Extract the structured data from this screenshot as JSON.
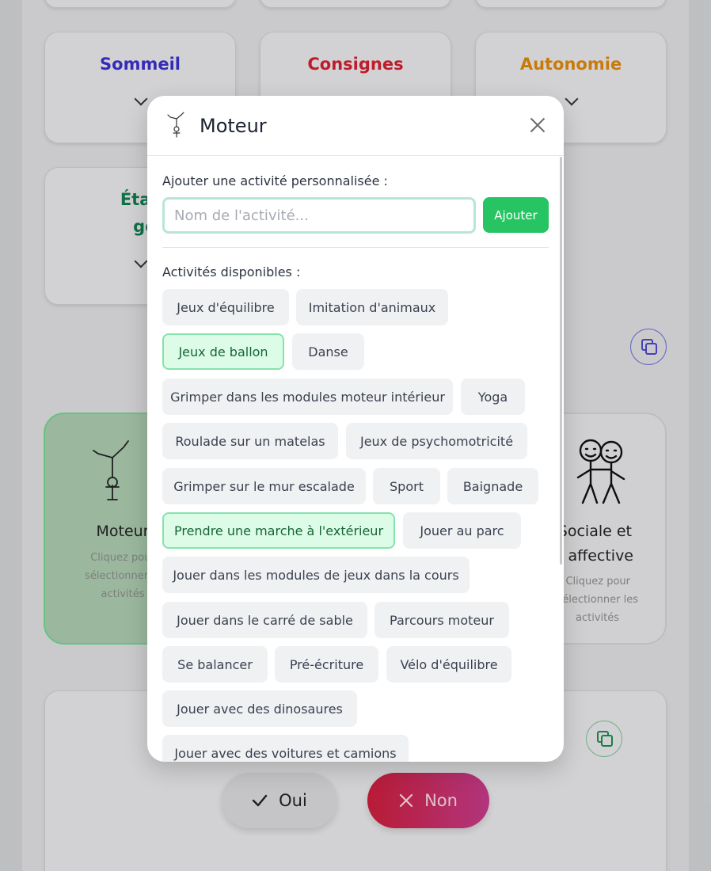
{
  "background": {
    "cards": [
      {
        "title": "Sommeil",
        "color": "#3b2fc9"
      },
      {
        "title": "Consignes",
        "color": "#d01f2f"
      },
      {
        "title": "Autonomie",
        "color": "#d9860a"
      }
    ],
    "state_card": {
      "line1": "État de",
      "line2": "génér",
      "color": "#127a4e"
    },
    "categories": {
      "moteur": {
        "title": "Moteur",
        "hint_line1": "Cliquez pour",
        "hint_line2": "sélectionner le",
        "hint_line3": "activités"
      },
      "sociale": {
        "title_line1": "Sociale et",
        "title_line2": "affective",
        "hint_line1": "Cliquez pour",
        "hint_line2": "électionner les",
        "hint_line3": "activités"
      }
    },
    "buttons": {
      "yes_label": "Oui",
      "no_label": "Non"
    }
  },
  "modal": {
    "title": "Moteur",
    "custom_label": "Ajouter une activité personnalisée :",
    "input_placeholder": "Nom de l'activité...",
    "add_label": "Ajouter",
    "available_label": "Activités disponibles :",
    "activities": [
      {
        "label": "Jeux d'équilibre",
        "selected": false
      },
      {
        "label": "Imitation d'animaux",
        "selected": false
      },
      {
        "label": "Jeux de ballon",
        "selected": true
      },
      {
        "label": "Danse",
        "selected": false
      },
      {
        "label": "Grimper dans les modules moteur intérieur",
        "selected": false
      },
      {
        "label": "Yoga",
        "selected": false
      },
      {
        "label": "Roulade sur un matelas",
        "selected": false
      },
      {
        "label": "Jeux de psychomotricité",
        "selected": false
      },
      {
        "label": "Grimper sur le mur escalade",
        "selected": false
      },
      {
        "label": "Sport",
        "selected": false
      },
      {
        "label": "Baignade",
        "selected": false
      },
      {
        "label": "Prendre une marche à l'extérieur",
        "selected": true
      },
      {
        "label": "Jouer au parc",
        "selected": false
      },
      {
        "label": "Jouer dans les modules de jeux dans la cours",
        "selected": false
      },
      {
        "label": "Jouer dans le carré de sable",
        "selected": false
      },
      {
        "label": "Parcours moteur",
        "selected": false
      },
      {
        "label": "Se balancer",
        "selected": false
      },
      {
        "label": "Pré-écriture",
        "selected": false
      },
      {
        "label": "Vélo d'équilibre",
        "selected": false
      },
      {
        "label": "Jouer avec des dinosaures",
        "selected": false
      },
      {
        "label": "Jouer avec des voitures et camions",
        "selected": false
      }
    ]
  }
}
